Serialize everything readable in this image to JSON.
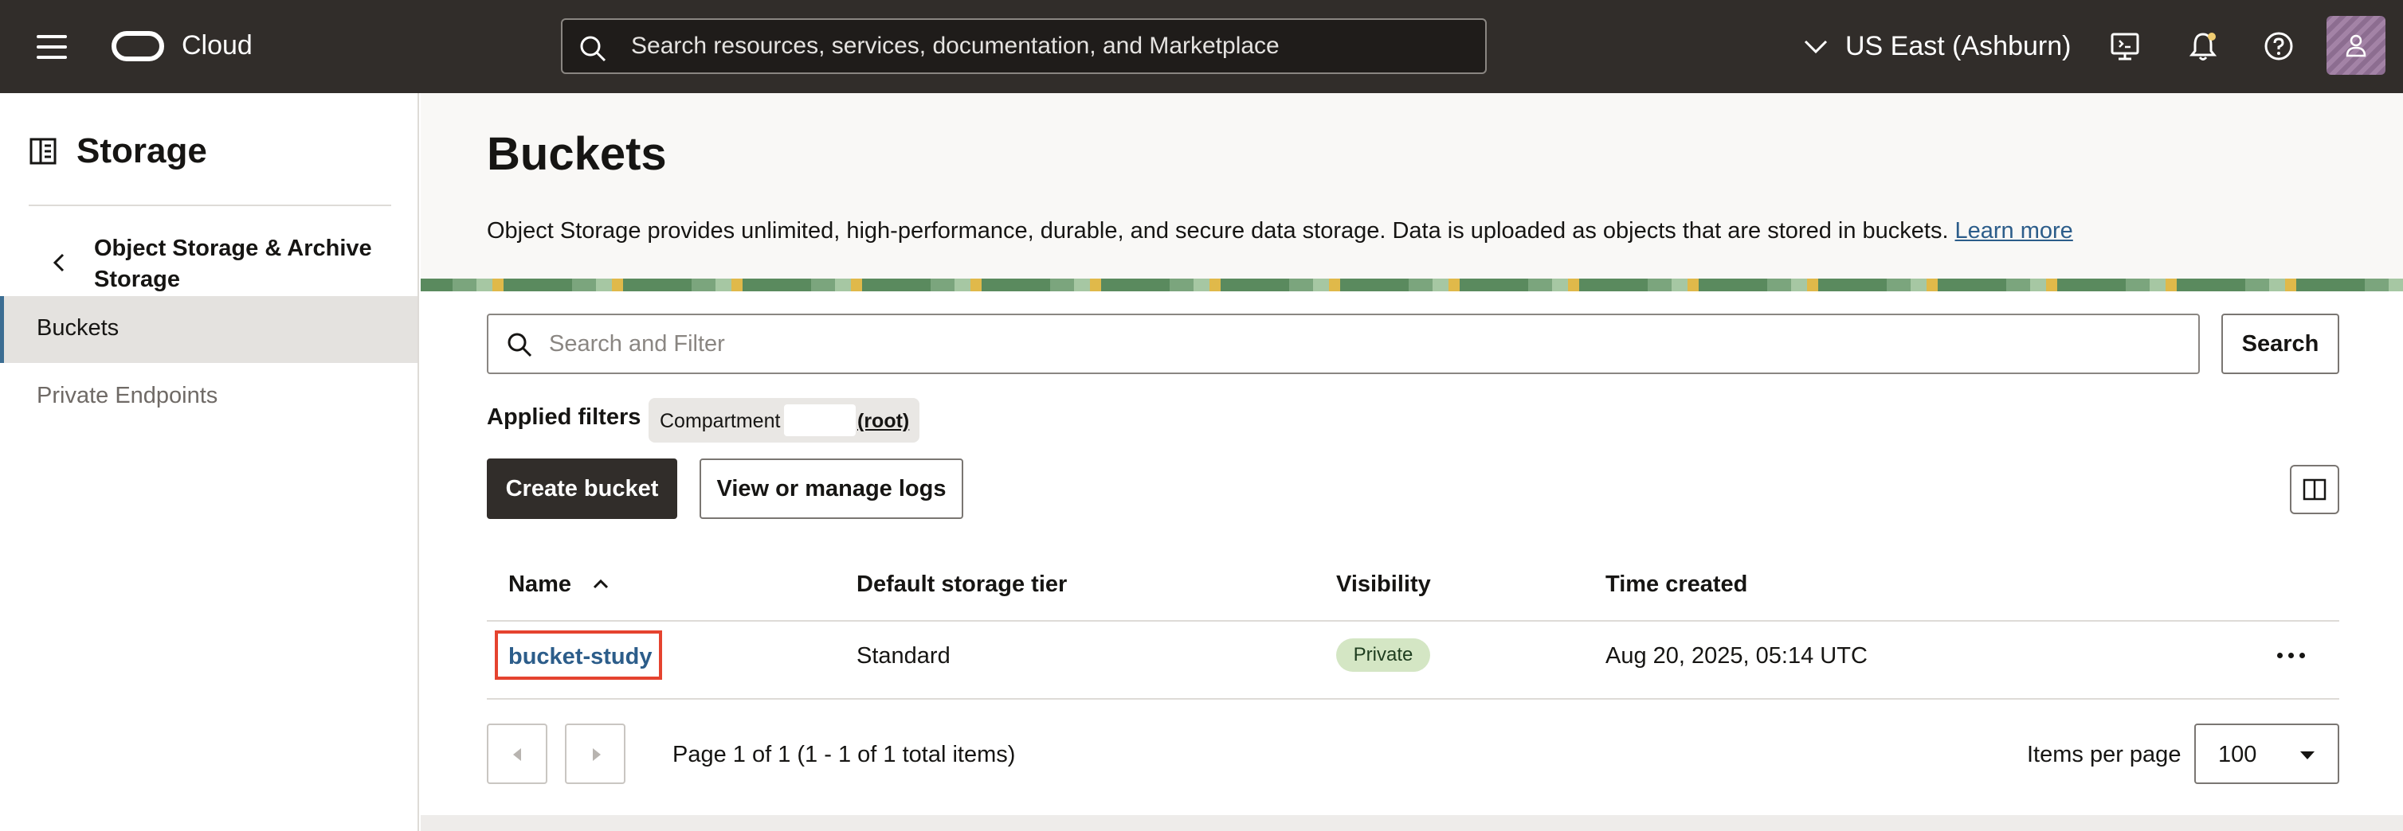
{
  "header": {
    "brand": "Cloud",
    "search_placeholder": "Search resources, services, documentation, and Marketplace",
    "region": "US East (Ashburn)"
  },
  "sidebar": {
    "title": "Storage",
    "parent": "Object Storage & Archive Storage",
    "items": [
      {
        "label": "Buckets",
        "active": true
      },
      {
        "label": "Private Endpoints",
        "active": false
      }
    ]
  },
  "main": {
    "title": "Buckets",
    "description": "Object Storage provides unlimited, high-performance, durable, and secure data storage. Data is uploaded as objects that are stored in buckets.",
    "learn_more": "Learn more",
    "filter_placeholder": "Search and Filter",
    "search_button": "Search",
    "applied_filters_label": "Applied filters",
    "filter_chip": {
      "key": "Compartment",
      "value": "(root)"
    },
    "create_button": "Create bucket",
    "logs_button": "View or manage logs",
    "table": {
      "columns": [
        "Name",
        "Default storage tier",
        "Visibility",
        "Time created"
      ],
      "rows": [
        {
          "name": "bucket-study",
          "tier": "Standard",
          "visibility": "Private",
          "created": "Aug 20, 2025, 05:14 UTC"
        }
      ]
    },
    "pagination": {
      "info": "Page 1 of 1 (1 - 1 of 1 total items)",
      "items_per_page_label": "Items per page",
      "items_per_page": "100"
    }
  },
  "colors": {
    "header_bg": "#312d2a",
    "link": "#2c5d8a",
    "active_nav_border": "#3c6e93",
    "highlight_box": "#e5432f",
    "badge_bg": "#d4e6c4"
  }
}
